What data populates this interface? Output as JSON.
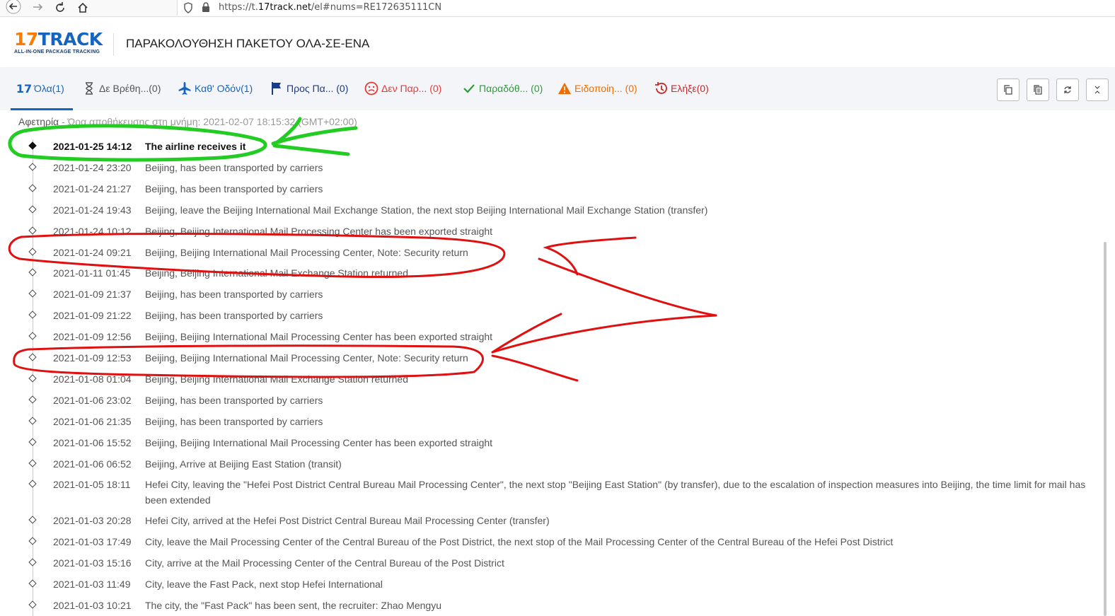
{
  "browser": {
    "url_prefix": "https://t.",
    "url_domain": "17track.net",
    "url_suffix": "/el#nums=RE172635111CN"
  },
  "header": {
    "logo_number": "17",
    "logo_word": "TRACK",
    "logo_tagline": "ALL-IN-ONE PACKAGE TRACKING",
    "title": "ΠΑΡΑΚΟΛΟΥΘΗΣΗ ΠΑΚΕΤΟΥ ΟΛΑ-ΣΕ-ΕΝΑ"
  },
  "tabs": [
    {
      "label": "Όλα(1)",
      "icon": "17-logo-icon",
      "color": "#1565c0"
    },
    {
      "label": "Δε Βρέθη...(0)",
      "icon": "hourglass-icon",
      "color": "#555555"
    },
    {
      "label": "Καθ' Οδόν(1)",
      "icon": "airplane-icon",
      "color": "#1565c0"
    },
    {
      "label": "Προς Πα...  (0)",
      "icon": "flag-icon",
      "color": "#1a3a8a"
    },
    {
      "label": "Δεν Παρ...  (0)",
      "icon": "sad-face-icon",
      "color": "#e53935"
    },
    {
      "label": "Παραδόθ... (0)",
      "icon": "checkmark-icon",
      "color": "#2e9a3a"
    },
    {
      "label": "Ειδοποίη... (0)",
      "icon": "warning-icon",
      "color": "#ef6c00"
    },
    {
      "label": "Ελήξε(0)",
      "icon": "history-icon",
      "color": "#c62828"
    }
  ],
  "origin": {
    "label": "Αφετηρία",
    "text": " - Ώρα αποθήκευσης στη μνήμη: 2021-02-07 18:15:32 (GMT+02:00)"
  },
  "events": [
    {
      "time": "2021-01-25 14:12",
      "desc": "The airline receives it"
    },
    {
      "time": "2021-01-24 23:20",
      "desc": "Beijing, has been transported by carriers"
    },
    {
      "time": "2021-01-24 21:27",
      "desc": "Beijing, has been transported by carriers"
    },
    {
      "time": "2021-01-24 19:43",
      "desc": "Beijing, leave the Beijing International Mail Exchange Station, the next stop Beijing International Mail Exchange Station (transfer)"
    },
    {
      "time": "2021-01-24 10:12",
      "desc": "Beijing, Beijing International Mail Processing Center has been exported straight"
    },
    {
      "time": "2021-01-24 09:21",
      "desc": "Beijing, Beijing International Mail Processing Center, Note: Security return"
    },
    {
      "time": "2021-01-11 01:45",
      "desc": "Beijing, Beijing International Mail Exchange Station returned"
    },
    {
      "time": "2021-01-09 21:37",
      "desc": "Beijing, has been transported by carriers"
    },
    {
      "time": "2021-01-09 21:22",
      "desc": "Beijing, has been transported by carriers"
    },
    {
      "time": "2021-01-09 12:56",
      "desc": "Beijing, Beijing International Mail Processing Center has been exported straight"
    },
    {
      "time": "2021-01-09 12:53",
      "desc": "Beijing, Beijing International Mail Processing Center, Note: Security return"
    },
    {
      "time": "2021-01-08 01:04",
      "desc": "Beijing, Beijing International Mail Exchange Station returned"
    },
    {
      "time": "2021-01-06 23:02",
      "desc": "Beijing, has been transported by carriers"
    },
    {
      "time": "2021-01-06 21:35",
      "desc": "Beijing, has been transported by carriers"
    },
    {
      "time": "2021-01-06 15:52",
      "desc": "Beijing, Beijing International Mail Processing Center has been exported straight"
    },
    {
      "time": "2021-01-06 06:52",
      "desc": "Beijing, Arrive at Beijing East Station (transit)"
    },
    {
      "time": "2021-01-05 18:11",
      "desc": "Hefei City, leaving the \"Hefei Post District Central Bureau Mail Processing Center\", the next stop \"Beijing East Station\" (by transfer), due to the escalation of inspection measures into Beijing, the time limit for mail has been extended"
    },
    {
      "time": "2021-01-03 20:28",
      "desc": "Hefei City, arrived at the Hefei Post District Central Bureau Mail Processing Center (transfer)"
    },
    {
      "time": "2021-01-03 17:49",
      "desc": "City, leave the Mail Processing Center of the Central Bureau of the Post District, the next stop of the Mail Processing Center of the Central Bureau of the Hefei Post District"
    },
    {
      "time": "2021-01-03 15:16",
      "desc": "City, arrive at the Mail Processing Center of the Central Bureau of the Post District"
    },
    {
      "time": "2021-01-03 11:49",
      "desc": "City, leave the Fast Pack, next stop Hefei International"
    },
    {
      "time": "2021-01-03 10:21",
      "desc": "The city, the \"Fast Pack\" has been sent, the recruiter: Zhao Mengyu"
    }
  ],
  "annotation_colors": {
    "green": "#22cc22",
    "red": "#e01010"
  }
}
